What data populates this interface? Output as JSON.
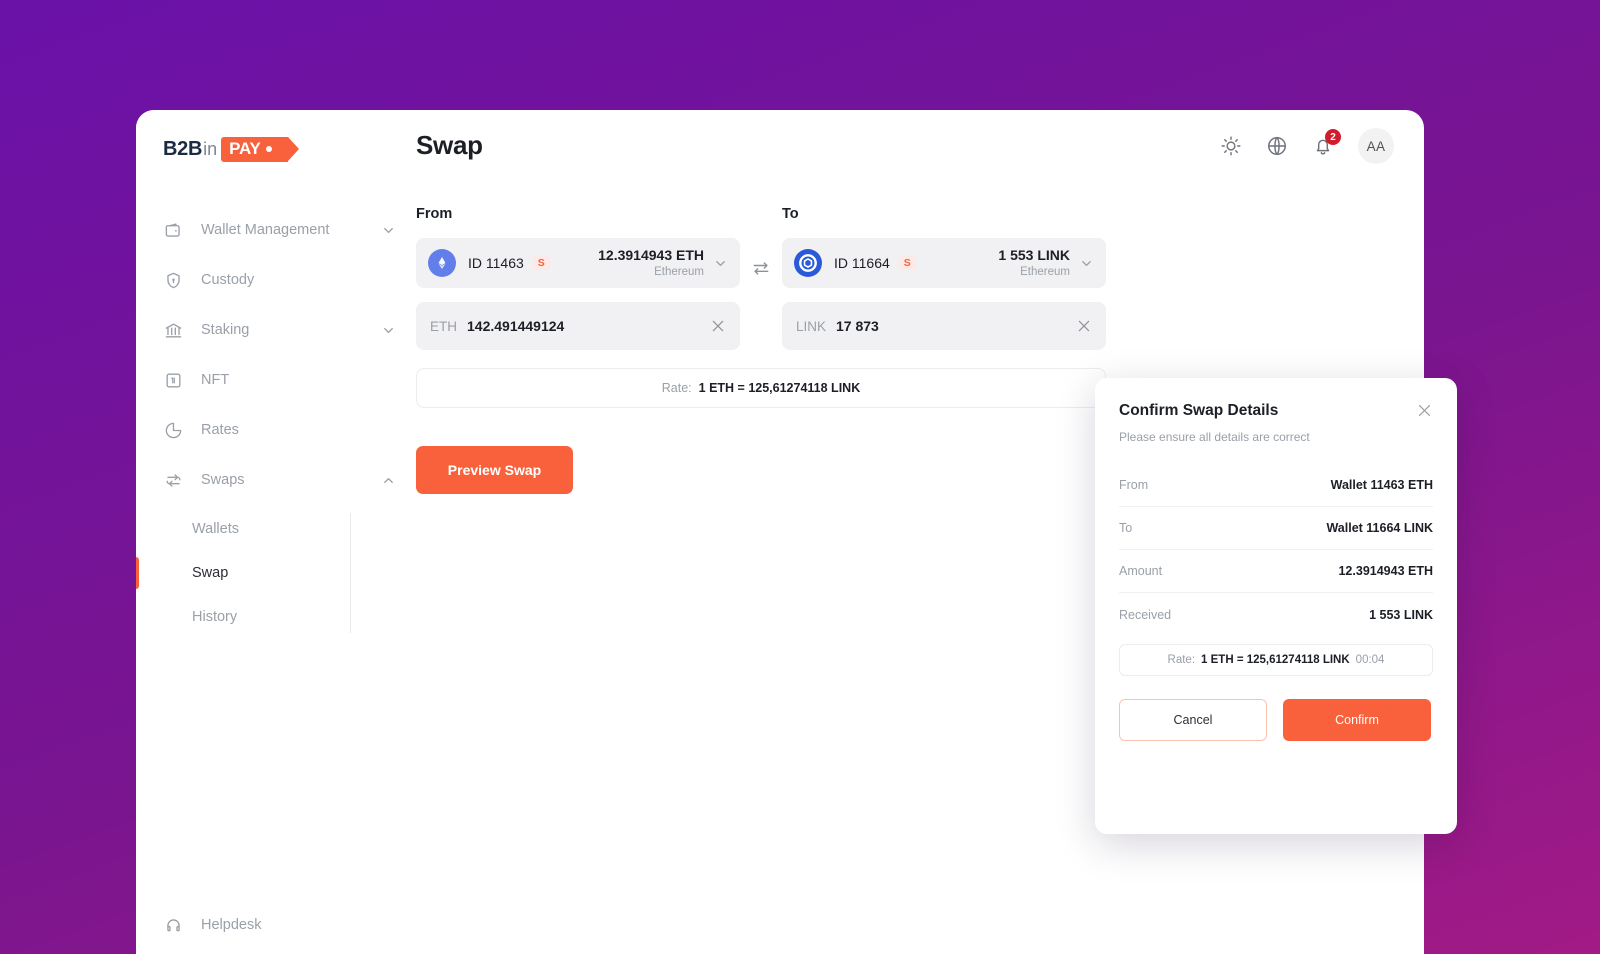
{
  "brand": {
    "logo_b2b": "B2B",
    "logo_in": "in",
    "logo_pay": "PAY",
    "accent_color": "#f8613c",
    "background_gradient_from": "#6a11a8",
    "background_gradient_to": "#a21a86"
  },
  "sidebar": {
    "items": [
      {
        "label": "Wallet Management",
        "icon": "wallet-icon",
        "expandable": true,
        "expanded": false
      },
      {
        "label": "Custody",
        "icon": "shield-icon",
        "expandable": false
      },
      {
        "label": "Staking",
        "icon": "bank-icon",
        "expandable": true,
        "expanded": false
      },
      {
        "label": "NFT",
        "icon": "nft-icon",
        "expandable": false
      },
      {
        "label": "Rates",
        "icon": "pie-chart-icon",
        "expandable": false
      },
      {
        "label": "Swaps",
        "icon": "swap-icon",
        "expandable": true,
        "expanded": true
      }
    ],
    "subitems": [
      {
        "label": "Wallets",
        "active": false
      },
      {
        "label": "Swap",
        "active": true
      },
      {
        "label": "History",
        "active": false
      }
    ],
    "helpdesk": {
      "label": "Helpdesk",
      "icon": "headset-icon"
    }
  },
  "header": {
    "title": "Swap",
    "icons": [
      {
        "name": "sun-icon"
      },
      {
        "name": "globe-icon"
      },
      {
        "name": "bell-icon",
        "badge": "2"
      }
    ],
    "avatar_initials": "AA"
  },
  "swap": {
    "from": {
      "label": "From",
      "wallet_id": "ID 11463",
      "badge": "S",
      "token_icon": "ethereum-icon",
      "balance": "12.3914943 ETH",
      "network": "Ethereum",
      "currency": "ETH",
      "amount": "142.491449124"
    },
    "to": {
      "label": "To",
      "wallet_id": "ID 11664",
      "badge": "S",
      "token_icon": "chainlink-icon",
      "balance": "1 553 LINK",
      "network": "Ethereum",
      "currency": "LINK",
      "amount": "17 873"
    },
    "rate_label": "Rate:",
    "rate_value": "1 ETH = 125,61274118 LINK",
    "preview_button": "Preview Swap"
  },
  "modal": {
    "title": "Confirm Swap Details",
    "subtitle": "Please ensure all details are correct",
    "rows": [
      {
        "label": "From",
        "value": "Wallet 11463 ETH"
      },
      {
        "label": "To",
        "value": "Wallet 11664 LINK"
      },
      {
        "label": "Amount",
        "value": "12.3914943 ETH"
      },
      {
        "label": "Received",
        "value": "1 553 LINK"
      }
    ],
    "rate_label": "Rate:",
    "rate_value": "1 ETH = 125,61274118 LINK",
    "rate_timer": "00:04",
    "cancel_button": "Cancel",
    "confirm_button": "Confirm"
  }
}
